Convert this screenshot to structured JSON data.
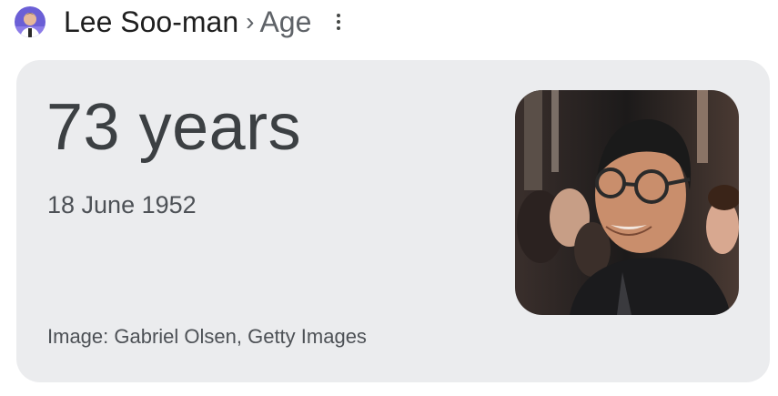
{
  "header": {
    "entity": "Lee Soo-man",
    "separator": "›",
    "attribute": "Age",
    "more_icon": "more-vert-icon"
  },
  "card": {
    "age": "73 years",
    "birth_date": "18 June 1952",
    "credit": "Image: Gabriel Olsen, Getty Images"
  },
  "colors": {
    "card_background": "#ebecee",
    "primary_text": "#3c4043",
    "secondary_text": "#4d5156"
  }
}
